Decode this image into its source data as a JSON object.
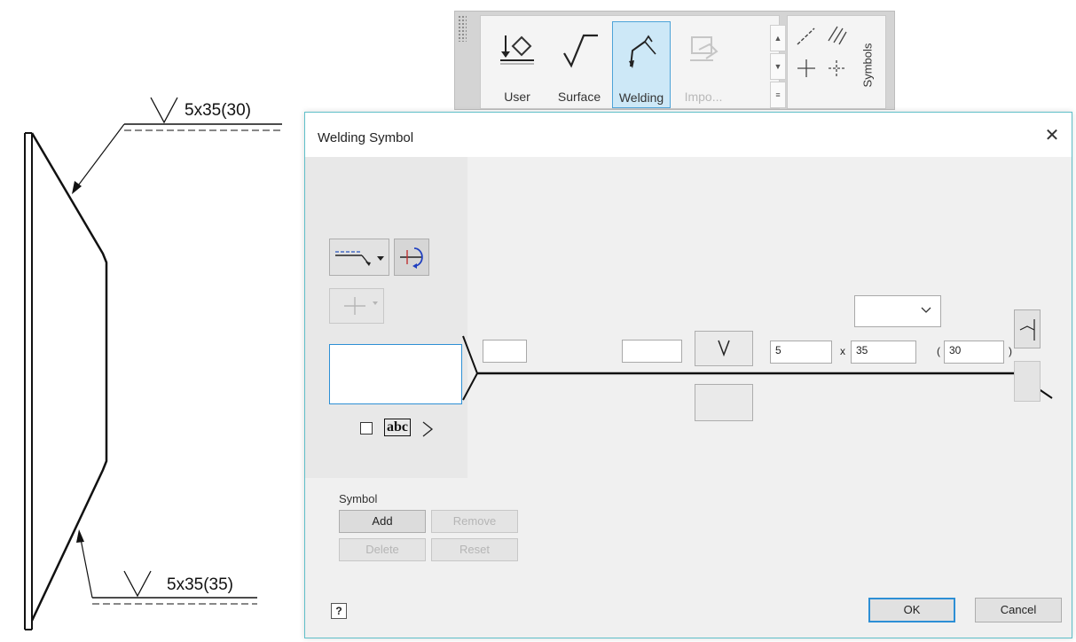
{
  "drawing": {
    "top_annotation": "5x35(30)",
    "bottom_annotation": "5x35(35)"
  },
  "ribbon": {
    "buttons": [
      {
        "label": "User",
        "icon": "user-symbol-icon",
        "state": "normal"
      },
      {
        "label": "Surface",
        "icon": "surface-texture-icon",
        "state": "normal"
      },
      {
        "label": "Welding",
        "icon": "welding-symbol-icon",
        "state": "active"
      },
      {
        "label": "Impo...",
        "icon": "import-symbol-icon",
        "state": "disabled"
      }
    ],
    "panel_label": "Symbols",
    "small_tools": [
      "datum-line-icon",
      "hatch-icon",
      "centerline-cross-icon",
      "center-mark-icon"
    ]
  },
  "dialog": {
    "title": "Welding Symbol",
    "close_icon": "close-icon",
    "fields": {
      "upper_left": "",
      "upper_mid": "",
      "size": "5",
      "length": "35",
      "pitch": "30",
      "tail_text": "",
      "contour_select": ""
    },
    "multiply_sign": "x",
    "paren_open": "(",
    "paren_close": ")",
    "symbol_group": {
      "label": "Symbol",
      "add": "Add",
      "remove": "Remove",
      "delete": "Delete",
      "reset": "Reset"
    },
    "help": "?",
    "ok": "OK",
    "cancel": "Cancel"
  },
  "colors": {
    "accent": "#2d8fd5",
    "dialog_border": "#5fbfc9",
    "active_ribbon": "#cde8f7"
  }
}
